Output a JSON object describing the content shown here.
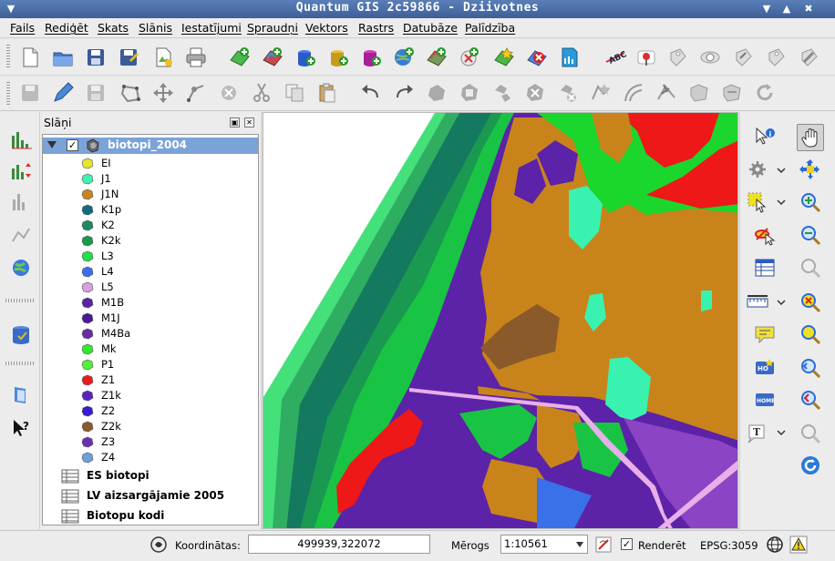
{
  "window": {
    "title": "Quantum GIS 2c59866 - Dziivotnes"
  },
  "menubar": {
    "items": [
      "Fails",
      "Rediģēt",
      "Skats",
      "Slānis",
      "Iestatījumi",
      "Spraudņi",
      "Vektors",
      "Rastrs",
      "Datubāze",
      "Palīdzība"
    ]
  },
  "layers_panel": {
    "title": "Slāņi",
    "active_layer": {
      "name": "biotopi_2004",
      "checked": true,
      "classes": [
        {
          "label": "EI",
          "color": "#e4e432"
        },
        {
          "label": "J1",
          "color": "#3ef2b4"
        },
        {
          "label": "J1N",
          "color": "#c98420"
        },
        {
          "label": "K1p",
          "color": "#126a80"
        },
        {
          "label": "K2",
          "color": "#1f8a62"
        },
        {
          "label": "K2k",
          "color": "#1a9a4a"
        },
        {
          "label": "L3",
          "color": "#20e046"
        },
        {
          "label": "L4",
          "color": "#3a6ef0"
        },
        {
          "label": "L5",
          "color": "#d8a0e0"
        },
        {
          "label": "M1B",
          "color": "#5a22a8"
        },
        {
          "label": "M1J",
          "color": "#4a1a98"
        },
        {
          "label": "M4Ba",
          "color": "#6a2ca0"
        },
        {
          "label": "Mk",
          "color": "#34e82c"
        },
        {
          "label": "P1",
          "color": "#52f03a"
        },
        {
          "label": "Z1",
          "color": "#ec1a1a"
        },
        {
          "label": "Z1k",
          "color": "#5a24c0"
        },
        {
          "label": "Z2",
          "color": "#3a1ad0"
        },
        {
          "label": "Z2k",
          "color": "#8a5a2a"
        },
        {
          "label": "Z3",
          "color": "#6a30b4"
        },
        {
          "label": "Z4",
          "color": "#6aa0dc"
        }
      ]
    },
    "other_layers": [
      "ES biotopi",
      "LV aizsargājamie 2005",
      "Biotopu kodi"
    ]
  },
  "statusbar": {
    "coord_label": "Koordinātas:",
    "coord_value": "499939,322072",
    "scale_label": "Mērogs",
    "scale_value": "1:10561",
    "render_label": "Renderēt",
    "render_checked": true,
    "epsg": "EPSG:3059"
  },
  "map_colors": {
    "brown": "#c8841a",
    "purple": "#5c22a8",
    "green": "#1bd62c",
    "teal": "#137a60",
    "cyan": "#3af2b0",
    "red": "#ee1818"
  }
}
